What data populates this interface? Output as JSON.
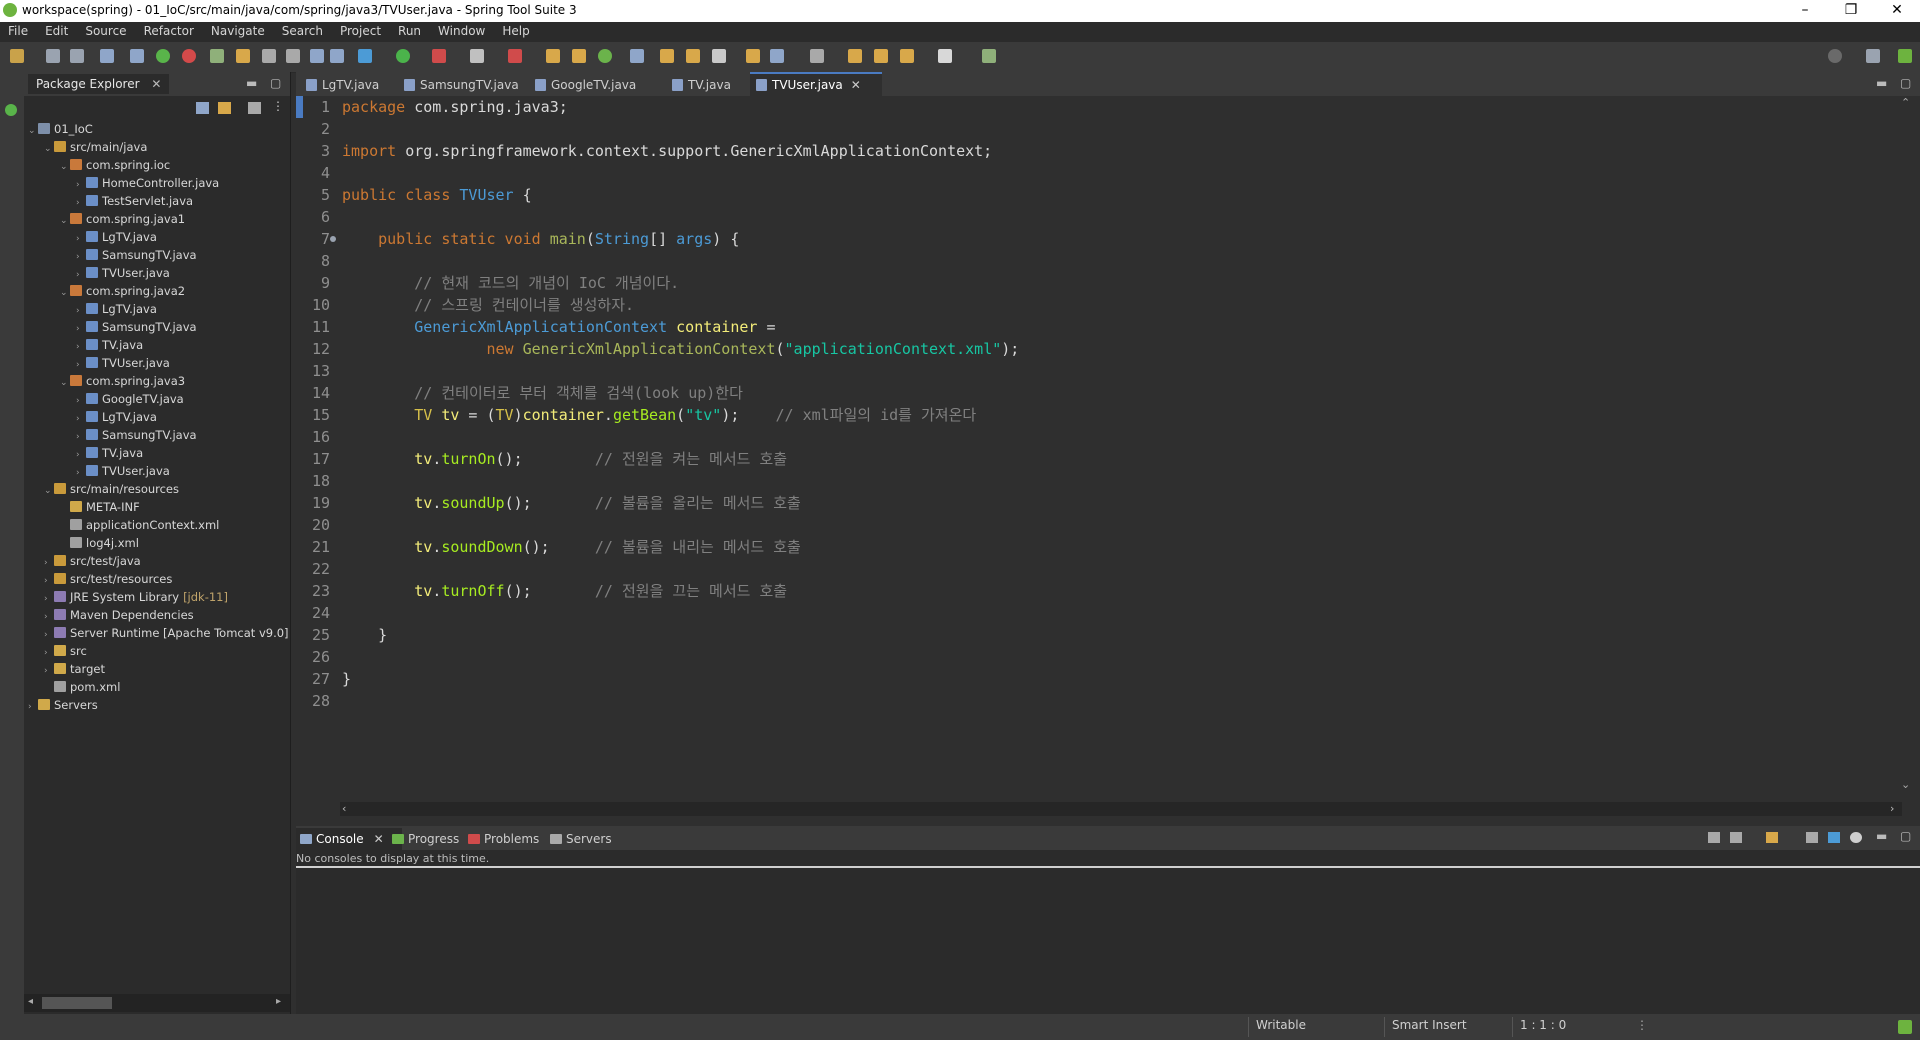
{
  "window": {
    "title": "workspace(spring) - 01_IoC/src/main/java/com/spring/java3/TVUser.java - Spring Tool Suite 3",
    "minimize": "–",
    "restore": "❐",
    "close": "✕"
  },
  "menu": [
    "File",
    "Edit",
    "Source",
    "Refactor",
    "Navigate",
    "Search",
    "Project",
    "Run",
    "Window",
    "Help"
  ],
  "explorer": {
    "tab_label": "Package Explorer",
    "tree": [
      {
        "label": "01_IoC",
        "icon": "project-icon",
        "depth": 0,
        "twisty": "v"
      },
      {
        "label": "src/main/java",
        "icon": "source-folder-icon",
        "depth": 1,
        "twisty": "v"
      },
      {
        "label": "com.spring.ioc",
        "icon": "package-icon",
        "depth": 2,
        "twisty": "v"
      },
      {
        "label": "HomeController.java",
        "icon": "java-file-icon",
        "depth": 3,
        "twisty": ">"
      },
      {
        "label": "TestServlet.java",
        "icon": "java-file-icon",
        "depth": 3,
        "twisty": ">"
      },
      {
        "label": "com.spring.java1",
        "icon": "package-icon",
        "depth": 2,
        "twisty": "v"
      },
      {
        "label": "LgTV.java",
        "icon": "java-file-icon",
        "depth": 3,
        "twisty": ">"
      },
      {
        "label": "SamsungTV.java",
        "icon": "java-file-icon",
        "depth": 3,
        "twisty": ">"
      },
      {
        "label": "TVUser.java",
        "icon": "java-file-icon",
        "depth": 3,
        "twisty": ">"
      },
      {
        "label": "com.spring.java2",
        "icon": "package-icon",
        "depth": 2,
        "twisty": "v"
      },
      {
        "label": "LgTV.java",
        "icon": "java-file-icon",
        "depth": 3,
        "twisty": ">"
      },
      {
        "label": "SamsungTV.java",
        "icon": "java-file-icon",
        "depth": 3,
        "twisty": ">"
      },
      {
        "label": "TV.java",
        "icon": "java-file-icon",
        "depth": 3,
        "twisty": ">"
      },
      {
        "label": "TVUser.java",
        "icon": "java-file-icon",
        "depth": 3,
        "twisty": ">"
      },
      {
        "label": "com.spring.java3",
        "icon": "package-icon",
        "depth": 2,
        "twisty": "v"
      },
      {
        "label": "GoogleTV.java",
        "icon": "java-file-icon",
        "depth": 3,
        "twisty": ">"
      },
      {
        "label": "LgTV.java",
        "icon": "java-file-icon",
        "depth": 3,
        "twisty": ">"
      },
      {
        "label": "SamsungTV.java",
        "icon": "java-file-icon",
        "depth": 3,
        "twisty": ">"
      },
      {
        "label": "TV.java",
        "icon": "java-file-icon",
        "depth": 3,
        "twisty": ">"
      },
      {
        "label": "TVUser.java",
        "icon": "java-file-icon",
        "depth": 3,
        "twisty": ">"
      },
      {
        "label": "src/main/resources",
        "icon": "source-folder-icon",
        "depth": 1,
        "twisty": "v"
      },
      {
        "label": "META-INF",
        "icon": "folder-icon",
        "depth": 2,
        "twisty": ""
      },
      {
        "label": "applicationContext.xml",
        "icon": "xml-file-icon",
        "depth": 2,
        "twisty": ""
      },
      {
        "label": "log4j.xml",
        "icon": "xml-file-icon",
        "depth": 2,
        "twisty": ""
      },
      {
        "label": "src/test/java",
        "icon": "source-folder-icon",
        "depth": 1,
        "twisty": ">"
      },
      {
        "label": "src/test/resources",
        "icon": "source-folder-icon",
        "depth": 1,
        "twisty": ">"
      },
      {
        "label": "JRE System Library",
        "suffix": "[jdk-11]",
        "icon": "library-icon",
        "depth": 1,
        "twisty": ">"
      },
      {
        "label": "Maven Dependencies",
        "icon": "library-icon",
        "depth": 1,
        "twisty": ">"
      },
      {
        "label": "Server Runtime [Apache Tomcat v9.0]",
        "icon": "library-icon",
        "depth": 1,
        "twisty": ">"
      },
      {
        "label": "src",
        "icon": "folder-icon",
        "depth": 1,
        "twisty": ">"
      },
      {
        "label": "target",
        "icon": "folder-icon",
        "depth": 1,
        "twisty": ">"
      },
      {
        "label": "pom.xml",
        "icon": "xml-file-icon",
        "depth": 1,
        "twisty": ""
      },
      {
        "label": "Servers",
        "icon": "folder-icon",
        "depth": 0,
        "twisty": ">"
      }
    ]
  },
  "editor": {
    "tabs": [
      "LgTV.java",
      "SamsungTV.java",
      "GoogleTV.java",
      "TV.java",
      "TVUser.java"
    ],
    "active_tab": "TVUser.java",
    "line_numbers": [
      "1",
      "2",
      "3",
      "4",
      "5",
      "6",
      "7",
      "8",
      "9",
      "10",
      "11",
      "12",
      "13",
      "14",
      "15",
      "16",
      "17",
      "18",
      "19",
      "20",
      "21",
      "22",
      "23",
      "24",
      "25",
      "26",
      "27",
      "28"
    ],
    "code": [
      [
        {
          "t": "package",
          "c": "kw"
        },
        {
          "t": " com.spring.java3;",
          "c": "pl"
        }
      ],
      [],
      [
        {
          "t": "import",
          "c": "kw"
        },
        {
          "t": " org.springframework.context.support.GenericXmlApplicationContext;",
          "c": "pl"
        }
      ],
      [],
      [
        {
          "t": "public class",
          "c": "kw"
        },
        {
          "t": " ",
          "c": "pl"
        },
        {
          "t": "TVUser",
          "c": "ty"
        },
        {
          "t": " {",
          "c": "pl"
        }
      ],
      [],
      [
        {
          "t": "    ",
          "c": "pl"
        },
        {
          "t": "public static void",
          "c": "kw"
        },
        {
          "t": " ",
          "c": "pl"
        },
        {
          "t": "main",
          "c": "fn"
        },
        {
          "t": "(",
          "c": "pl"
        },
        {
          "t": "String",
          "c": "ty"
        },
        {
          "t": "[] ",
          "c": "pl"
        },
        {
          "t": "args",
          "c": "ty"
        },
        {
          "t": ") {",
          "c": "pl"
        }
      ],
      [],
      [
        {
          "t": "        // 현재 코드의 개념이 IoC 개념이다.",
          "c": "cm"
        }
      ],
      [
        {
          "t": "        // 스프링 컨테이너를 생성하자.",
          "c": "cm"
        }
      ],
      [
        {
          "t": "        ",
          "c": "pl"
        },
        {
          "t": "GenericXmlApplicationContext",
          "c": "ty"
        },
        {
          "t": " ",
          "c": "pl"
        },
        {
          "t": "container",
          "c": "vr"
        },
        {
          "t": " =",
          "c": "pl"
        }
      ],
      [
        {
          "t": "                ",
          "c": "pl"
        },
        {
          "t": "new",
          "c": "kw"
        },
        {
          "t": " ",
          "c": "pl"
        },
        {
          "t": "GenericXmlApplicationContext",
          "c": "fn"
        },
        {
          "t": "(",
          "c": "pl"
        },
        {
          "t": "\"applicationContext.xml\"",
          "c": "st"
        },
        {
          "t": ");",
          "c": "pl"
        }
      ],
      [],
      [
        {
          "t": "        // 컨테이터로 부터 객체를 검색(look up)한다",
          "c": "cm"
        }
      ],
      [
        {
          "t": "        ",
          "c": "pl"
        },
        {
          "t": "TV",
          "c": "tv"
        },
        {
          "t": " ",
          "c": "pl"
        },
        {
          "t": "tv",
          "c": "vr"
        },
        {
          "t": " = (",
          "c": "pl"
        },
        {
          "t": "TV",
          "c": "tv"
        },
        {
          "t": ")",
          "c": "pl"
        },
        {
          "t": "container",
          "c": "vr"
        },
        {
          "t": ".",
          "c": "pl"
        },
        {
          "t": "getBean",
          "c": "mt"
        },
        {
          "t": "(",
          "c": "pl"
        },
        {
          "t": "\"tv\"",
          "c": "st"
        },
        {
          "t": ");    ",
          "c": "pl"
        },
        {
          "t": "// xml파일의 id를 가져온다",
          "c": "cm"
        }
      ],
      [],
      [
        {
          "t": "        ",
          "c": "pl"
        },
        {
          "t": "tv",
          "c": "vr"
        },
        {
          "t": ".",
          "c": "pl"
        },
        {
          "t": "turnOn",
          "c": "mt"
        },
        {
          "t": "();        ",
          "c": "pl"
        },
        {
          "t": "// 전원을 켜는 메서드 호출",
          "c": "cm"
        }
      ],
      [],
      [
        {
          "t": "        ",
          "c": "pl"
        },
        {
          "t": "tv",
          "c": "vr"
        },
        {
          "t": ".",
          "c": "pl"
        },
        {
          "t": "soundUp",
          "c": "mt"
        },
        {
          "t": "();       ",
          "c": "pl"
        },
        {
          "t": "// 볼륨을 올리는 메서드 호출",
          "c": "cm"
        }
      ],
      [],
      [
        {
          "t": "        ",
          "c": "pl"
        },
        {
          "t": "tv",
          "c": "vr"
        },
        {
          "t": ".",
          "c": "pl"
        },
        {
          "t": "soundDown",
          "c": "mt"
        },
        {
          "t": "();     ",
          "c": "pl"
        },
        {
          "t": "// 볼륨을 내리는 메서드 호출",
          "c": "cm"
        }
      ],
      [],
      [
        {
          "t": "        ",
          "c": "pl"
        },
        {
          "t": "tv",
          "c": "vr"
        },
        {
          "t": ".",
          "c": "pl"
        },
        {
          "t": "turnOff",
          "c": "mt"
        },
        {
          "t": "();       ",
          "c": "pl"
        },
        {
          "t": "// 전원을 끄는 메서드 호출",
          "c": "cm"
        }
      ],
      [],
      [
        {
          "t": "    }",
          "c": "pl"
        }
      ],
      [],
      [
        {
          "t": "}",
          "c": "pl"
        }
      ],
      []
    ]
  },
  "console": {
    "tabs": [
      "Console",
      "Progress",
      "Problems",
      "Servers"
    ],
    "active_tab": "Console",
    "message": "No consoles to display at this time."
  },
  "status": {
    "writable": "Writable",
    "insert_mode": "Smart Insert",
    "position": "1 : 1 : 0"
  },
  "colors": {
    "keyword": "#cc7832",
    "type": "#4c9bd6",
    "string": "#17c6a3",
    "comment": "#808080",
    "spring_accent": "#6db33f"
  }
}
